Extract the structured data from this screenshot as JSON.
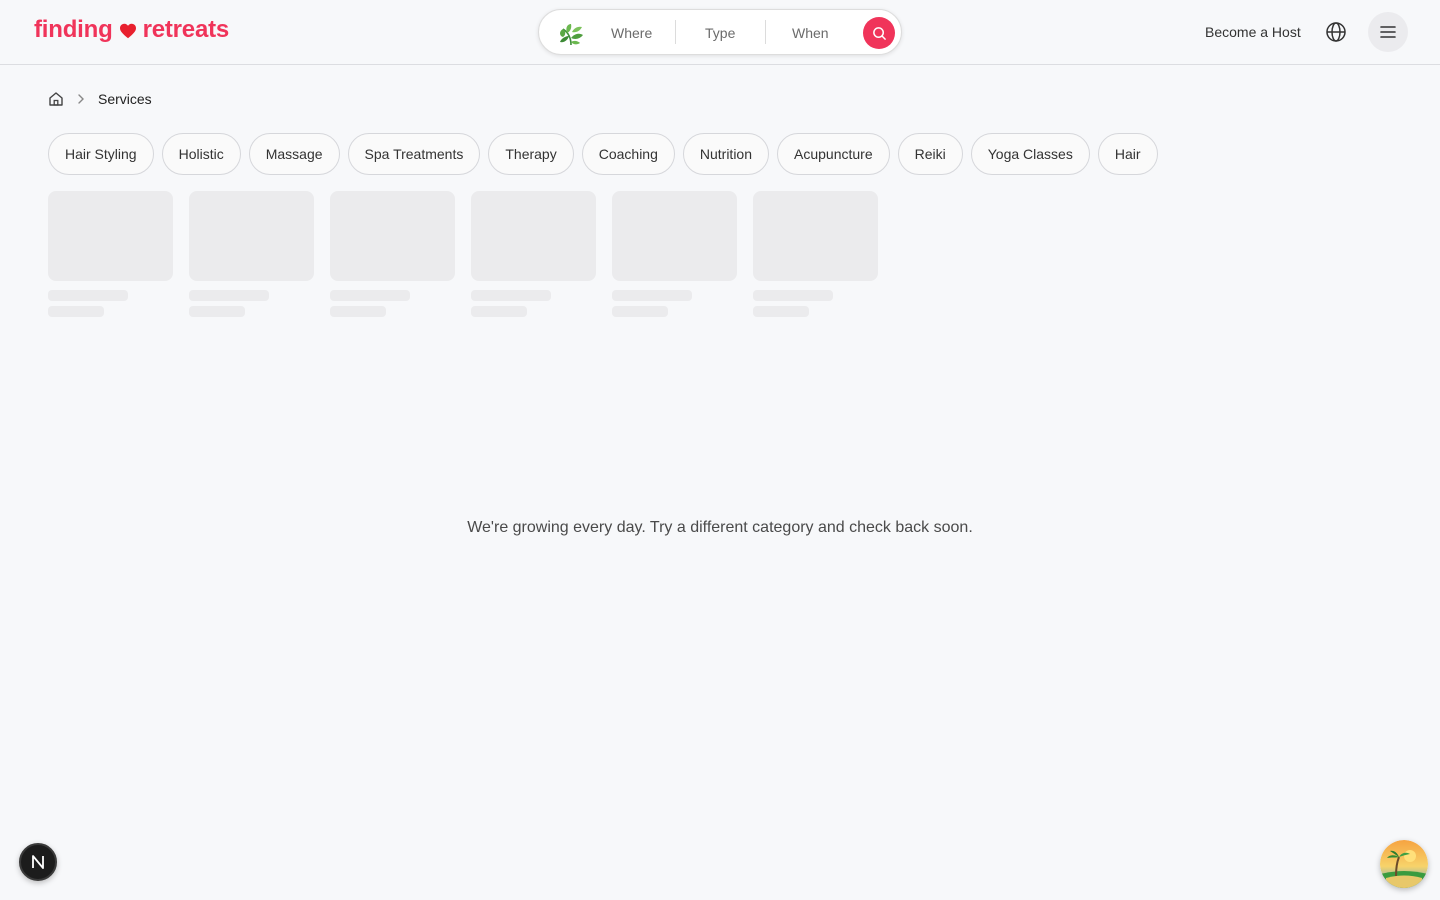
{
  "header": {
    "logo": {
      "word1": "finding",
      "word2": "retreats",
      "color": "#f0345a"
    },
    "search": {
      "where_label": "Where",
      "type_label": "Type",
      "when_label": "When"
    },
    "become_host_label": "Become a Host"
  },
  "breadcrumb": {
    "current": "Services"
  },
  "categories": [
    "Hair Styling",
    "Holistic",
    "Massage",
    "Spa Treatments",
    "Therapy",
    "Coaching",
    "Nutrition",
    "Acupuncture",
    "Reiki",
    "Yoga Classes",
    "Hair"
  ],
  "empty_message": "We're growing every day. Try a different category and check back soon.",
  "floating": {
    "n_badge_label": "N"
  },
  "colors": {
    "accent": "#f0345a",
    "background": "#f7f8fa",
    "skeleton": "#ebebed"
  }
}
